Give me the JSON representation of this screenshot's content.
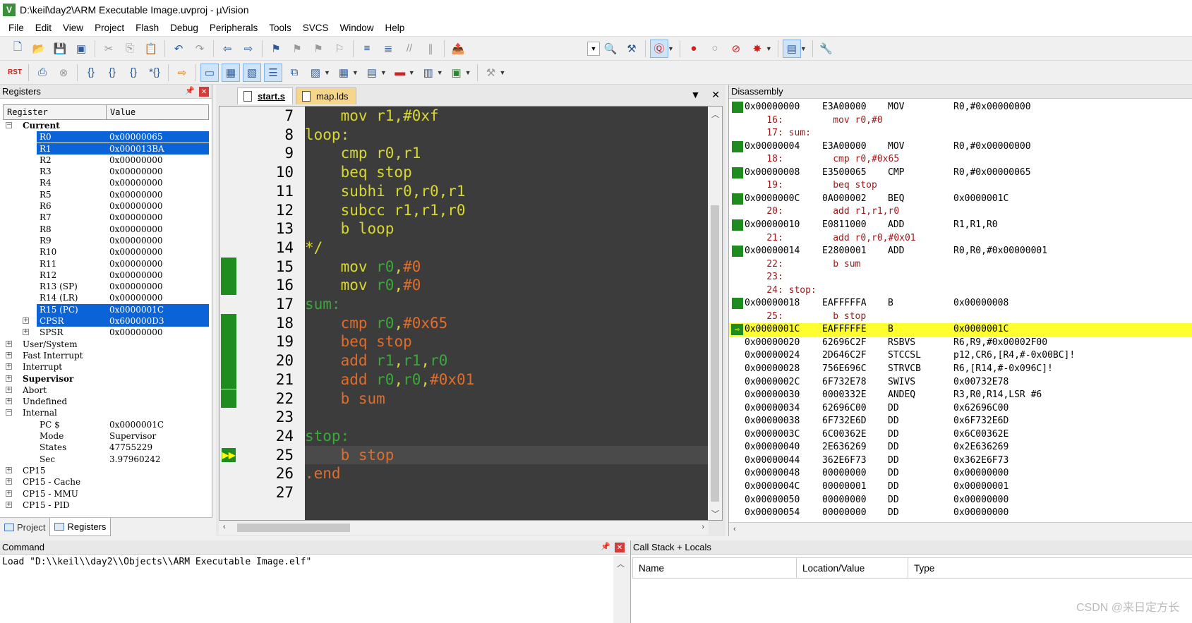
{
  "window": {
    "title": "D:\\keil\\day2\\ARM Executable Image.uvproj - µVision",
    "icon": "V"
  },
  "menu": [
    "File",
    "Edit",
    "View",
    "Project",
    "Flash",
    "Debug",
    "Peripherals",
    "Tools",
    "SVCS",
    "Window",
    "Help"
  ],
  "registers": {
    "title": "Registers",
    "col_register": "Register",
    "col_value": "Value",
    "rows": [
      {
        "name": "Current",
        "value": "",
        "level": 0,
        "exp": "-",
        "bold": true,
        "sel": false
      },
      {
        "name": "R0",
        "value": "0x00000065",
        "level": 2,
        "exp": "",
        "bold": false,
        "sel": true
      },
      {
        "name": "R1",
        "value": "0x000013BA",
        "level": 2,
        "exp": "",
        "bold": false,
        "sel": true
      },
      {
        "name": "R2",
        "value": "0x00000000",
        "level": 2,
        "exp": "",
        "bold": false,
        "sel": false
      },
      {
        "name": "R3",
        "value": "0x00000000",
        "level": 2,
        "exp": "",
        "bold": false,
        "sel": false
      },
      {
        "name": "R4",
        "value": "0x00000000",
        "level": 2,
        "exp": "",
        "bold": false,
        "sel": false
      },
      {
        "name": "R5",
        "value": "0x00000000",
        "level": 2,
        "exp": "",
        "bold": false,
        "sel": false
      },
      {
        "name": "R6",
        "value": "0x00000000",
        "level": 2,
        "exp": "",
        "bold": false,
        "sel": false
      },
      {
        "name": "R7",
        "value": "0x00000000",
        "level": 2,
        "exp": "",
        "bold": false,
        "sel": false
      },
      {
        "name": "R8",
        "value": "0x00000000",
        "level": 2,
        "exp": "",
        "bold": false,
        "sel": false
      },
      {
        "name": "R9",
        "value": "0x00000000",
        "level": 2,
        "exp": "",
        "bold": false,
        "sel": false
      },
      {
        "name": "R10",
        "value": "0x00000000",
        "level": 2,
        "exp": "",
        "bold": false,
        "sel": false
      },
      {
        "name": "R11",
        "value": "0x00000000",
        "level": 2,
        "exp": "",
        "bold": false,
        "sel": false
      },
      {
        "name": "R12",
        "value": "0x00000000",
        "level": 2,
        "exp": "",
        "bold": false,
        "sel": false
      },
      {
        "name": "R13 (SP)",
        "value": "0x00000000",
        "level": 2,
        "exp": "",
        "bold": false,
        "sel": false
      },
      {
        "name": "R14 (LR)",
        "value": "0x00000000",
        "level": 2,
        "exp": "",
        "bold": false,
        "sel": false
      },
      {
        "name": "R15 (PC)",
        "value": "0x0000001C",
        "level": 2,
        "exp": "",
        "bold": false,
        "sel": true
      },
      {
        "name": "CPSR",
        "value": "0x600000D3",
        "level": 2,
        "exp": "+",
        "bold": false,
        "sel": true
      },
      {
        "name": "SPSR",
        "value": "0x00000000",
        "level": 2,
        "exp": "+",
        "bold": false,
        "sel": false
      },
      {
        "name": "User/System",
        "value": "",
        "level": 0,
        "exp": "+",
        "bold": false,
        "sel": false
      },
      {
        "name": "Fast Interrupt",
        "value": "",
        "level": 0,
        "exp": "+",
        "bold": false,
        "sel": false
      },
      {
        "name": "Interrupt",
        "value": "",
        "level": 0,
        "exp": "+",
        "bold": false,
        "sel": false
      },
      {
        "name": "Supervisor",
        "value": "",
        "level": 0,
        "exp": "+",
        "bold": true,
        "sel": false
      },
      {
        "name": "Abort",
        "value": "",
        "level": 0,
        "exp": "+",
        "bold": false,
        "sel": false
      },
      {
        "name": "Undefined",
        "value": "",
        "level": 0,
        "exp": "+",
        "bold": false,
        "sel": false
      },
      {
        "name": "Internal",
        "value": "",
        "level": 0,
        "exp": "-",
        "bold": false,
        "sel": false
      },
      {
        "name": "PC  $",
        "value": "0x0000001C",
        "level": 2,
        "exp": "",
        "bold": false,
        "sel": false
      },
      {
        "name": "Mode",
        "value": "Supervisor",
        "level": 2,
        "exp": "",
        "bold": false,
        "sel": false
      },
      {
        "name": "States",
        "value": "47755229",
        "level": 2,
        "exp": "",
        "bold": false,
        "sel": false
      },
      {
        "name": "Sec",
        "value": "3.97960242",
        "level": 2,
        "exp": "",
        "bold": false,
        "sel": false
      },
      {
        "name": "CP15",
        "value": "",
        "level": 0,
        "exp": "+",
        "bold": false,
        "sel": false
      },
      {
        "name": "CP15 - Cache",
        "value": "",
        "level": 0,
        "exp": "+",
        "bold": false,
        "sel": false
      },
      {
        "name": "CP15 - MMU",
        "value": "",
        "level": 0,
        "exp": "+",
        "bold": false,
        "sel": false
      },
      {
        "name": "CP15 - PID",
        "value": "",
        "level": 0,
        "exp": "+",
        "bold": false,
        "sel": false
      }
    ],
    "tabs": [
      {
        "label": "Project",
        "active": false
      },
      {
        "label": "Registers",
        "active": true
      }
    ]
  },
  "editor": {
    "tabs": [
      {
        "label": "start.s",
        "active": true
      },
      {
        "label": "map.lds",
        "active": false
      }
    ],
    "lines": [
      {
        "num": "7",
        "tokens": [
          [
            "    mov r1,#0xf",
            "kw"
          ]
        ],
        "mark": false,
        "cur": false,
        "arrow": false
      },
      {
        "num": "8",
        "tokens": [
          [
            "loop:",
            "kw"
          ]
        ],
        "mark": false,
        "cur": false,
        "arrow": false
      },
      {
        "num": "9",
        "tokens": [
          [
            "    cmp r0,r1",
            "kw"
          ]
        ],
        "mark": false,
        "cur": false,
        "arrow": false
      },
      {
        "num": "10",
        "tokens": [
          [
            "    beq stop",
            "kw"
          ]
        ],
        "mark": false,
        "cur": false,
        "arrow": false
      },
      {
        "num": "11",
        "tokens": [
          [
            "    subhi r0,r0,r1",
            "kw"
          ]
        ],
        "mark": false,
        "cur": false,
        "arrow": false
      },
      {
        "num": "12",
        "tokens": [
          [
            "    subcc r1,r1,r0",
            "kw"
          ]
        ],
        "mark": false,
        "cur": false,
        "arrow": false
      },
      {
        "num": "13",
        "tokens": [
          [
            "    b loop",
            "kw"
          ]
        ],
        "mark": false,
        "cur": false,
        "arrow": false
      },
      {
        "num": "14",
        "tokens": [
          [
            "*/",
            "kw"
          ]
        ],
        "mark": false,
        "cur": false,
        "arrow": false
      },
      {
        "num": "15",
        "tokens": [
          [
            "    mov ",
            "kw"
          ],
          [
            "r0",
            "rg"
          ],
          [
            ",",
            "kw"
          ],
          [
            "#0",
            "lb2"
          ]
        ],
        "mark": true,
        "cur": false,
        "arrow": false
      },
      {
        "num": "16",
        "tokens": [
          [
            "    mov ",
            "kw"
          ],
          [
            "r0",
            "rg"
          ],
          [
            ",",
            "kw"
          ],
          [
            "#0",
            "lb2"
          ]
        ],
        "mark": true,
        "cur": false,
        "arrow": false
      },
      {
        "num": "17",
        "tokens": [
          [
            "sum:",
            "lb"
          ]
        ],
        "mark": false,
        "cur": false,
        "arrow": false
      },
      {
        "num": "18",
        "tokens": [
          [
            "    cmp ",
            "lb2"
          ],
          [
            "r0",
            "rg"
          ],
          [
            ",",
            "kw"
          ],
          [
            "#0x65",
            "lb2"
          ]
        ],
        "mark": true,
        "cur": false,
        "arrow": false
      },
      {
        "num": "19",
        "tokens": [
          [
            "    beq ",
            "lb2"
          ],
          [
            "stop",
            "lb2"
          ]
        ],
        "mark": true,
        "cur": false,
        "arrow": false
      },
      {
        "num": "20",
        "tokens": [
          [
            "    add ",
            "lb2"
          ],
          [
            "r1",
            "rg"
          ],
          [
            ",",
            "kw"
          ],
          [
            "r1",
            "rg"
          ],
          [
            ",",
            "kw"
          ],
          [
            "r0",
            "rg"
          ]
        ],
        "mark": true,
        "cur": false,
        "arrow": false
      },
      {
        "num": "21",
        "tokens": [
          [
            "    add ",
            "lb2"
          ],
          [
            "r0",
            "rg"
          ],
          [
            ",",
            "kw"
          ],
          [
            "r0",
            "rg"
          ],
          [
            ",",
            "kw"
          ],
          [
            "#0x01",
            "lb2"
          ]
        ],
        "mark": true,
        "cur": false,
        "arrow": false
      },
      {
        "num": "22",
        "tokens": [
          [
            "    b ",
            "lb2"
          ],
          [
            "sum",
            "lb2"
          ]
        ],
        "mark": true,
        "cur": false,
        "arrow": false
      },
      {
        "num": "23",
        "tokens": [
          [
            "",
            "kw"
          ]
        ],
        "mark": false,
        "cur": false,
        "arrow": false
      },
      {
        "num": "24",
        "tokens": [
          [
            "stop:",
            "lb"
          ]
        ],
        "mark": false,
        "cur": false,
        "arrow": false
      },
      {
        "num": "25",
        "tokens": [
          [
            "    b ",
            "lb2"
          ],
          [
            "stop",
            "lb2"
          ]
        ],
        "mark": false,
        "cur": true,
        "arrow": true
      },
      {
        "num": "26",
        "tokens": [
          [
            ".end",
            "dir"
          ]
        ],
        "mark": false,
        "cur": false,
        "arrow": false
      },
      {
        "num": "27",
        "tokens": [
          [
            "",
            "kw"
          ]
        ],
        "mark": false,
        "cur": false,
        "arrow": false
      }
    ]
  },
  "disassembly": {
    "title": "Disassembly",
    "rows": [
      {
        "t": "asm",
        "addr": "0x00000000",
        "op": "E3A00000",
        "mn": "MOV",
        "args": "R0,#0x00000000",
        "mark": true
      },
      {
        "t": "src",
        "text": "    16:         mov r0,#0"
      },
      {
        "t": "src",
        "text": "    17: sum:"
      },
      {
        "t": "asm",
        "addr": "0x00000004",
        "op": "E3A00000",
        "mn": "MOV",
        "args": "R0,#0x00000000",
        "mark": true
      },
      {
        "t": "src",
        "text": "    18:         cmp r0,#0x65"
      },
      {
        "t": "asm",
        "addr": "0x00000008",
        "op": "E3500065",
        "mn": "CMP",
        "args": "R0,#0x00000065",
        "mark": true
      },
      {
        "t": "src",
        "text": "    19:         beq stop"
      },
      {
        "t": "asm",
        "addr": "0x0000000C",
        "op": "0A000002",
        "mn": "BEQ",
        "args": "0x0000001C",
        "mark": true
      },
      {
        "t": "src",
        "text": "    20:         add r1,r1,r0"
      },
      {
        "t": "asm",
        "addr": "0x00000010",
        "op": "E0811000",
        "mn": "ADD",
        "args": "R1,R1,R0",
        "mark": true
      },
      {
        "t": "src",
        "text": "    21:         add r0,r0,#0x01"
      },
      {
        "t": "asm",
        "addr": "0x00000014",
        "op": "E2800001",
        "mn": "ADD",
        "args": "R0,R0,#0x00000001",
        "mark": true
      },
      {
        "t": "src",
        "text": "    22:         b sum"
      },
      {
        "t": "src",
        "text": "    23:"
      },
      {
        "t": "src",
        "text": "    24: stop:"
      },
      {
        "t": "asm",
        "addr": "0x00000018",
        "op": "EAFFFFFA",
        "mn": "B",
        "args": "0x00000008",
        "mark": true
      },
      {
        "t": "src",
        "text": "    25:         b stop"
      },
      {
        "t": "asm",
        "addr": "0x0000001C",
        "op": "EAFFFFFE",
        "mn": "B",
        "args": "0x0000001C",
        "mark": true,
        "hl": true
      },
      {
        "t": "asm",
        "addr": "0x00000020",
        "op": "62696C2F",
        "mn": "RSBVS",
        "args": "R6,R9,#0x00002F00",
        "mark": false
      },
      {
        "t": "asm",
        "addr": "0x00000024",
        "op": "2D646C2F",
        "mn": "STCCSL",
        "args": "p12,CR6,[R4,#-0x00BC]!",
        "mark": false
      },
      {
        "t": "asm",
        "addr": "0x00000028",
        "op": "756E696C",
        "mn": "STRVCB",
        "args": "R6,[R14,#-0x096C]!",
        "mark": false
      },
      {
        "t": "asm",
        "addr": "0x0000002C",
        "op": "6F732E78",
        "mn": "SWIVS",
        "args": "0x00732E78",
        "mark": false
      },
      {
        "t": "asm",
        "addr": "0x00000030",
        "op": "0000332E",
        "mn": "ANDEQ",
        "args": "R3,R0,R14,LSR #6",
        "mark": false
      },
      {
        "t": "asm",
        "addr": "0x00000034",
        "op": "62696C00",
        "mn": "DD",
        "args": "0x62696C00",
        "mark": false
      },
      {
        "t": "asm",
        "addr": "0x00000038",
        "op": "6F732E6D",
        "mn": "DD",
        "args": "0x6F732E6D",
        "mark": false
      },
      {
        "t": "asm",
        "addr": "0x0000003C",
        "op": "6C00362E",
        "mn": "DD",
        "args": "0x6C00362E",
        "mark": false
      },
      {
        "t": "asm",
        "addr": "0x00000040",
        "op": "2E636269",
        "mn": "DD",
        "args": "0x2E636269",
        "mark": false
      },
      {
        "t": "asm",
        "addr": "0x00000044",
        "op": "362E6F73",
        "mn": "DD",
        "args": "0x362E6F73",
        "mark": false
      },
      {
        "t": "asm",
        "addr": "0x00000048",
        "op": "00000000",
        "mn": "DD",
        "args": "0x00000000",
        "mark": false
      },
      {
        "t": "asm",
        "addr": "0x0000004C",
        "op": "00000001",
        "mn": "DD",
        "args": "0x00000001",
        "mark": false
      },
      {
        "t": "asm",
        "addr": "0x00000050",
        "op": "00000000",
        "mn": "DD",
        "args": "0x00000000",
        "mark": false
      },
      {
        "t": "asm",
        "addr": "0x00000054",
        "op": "00000000",
        "mn": "DD",
        "args": "0x00000000",
        "mark": false
      }
    ]
  },
  "command": {
    "title": "Command",
    "text": "Load \"D:\\\\keil\\\\day2\\\\Objects\\\\ARM Executable Image.elf\""
  },
  "callstack": {
    "title": "Call Stack + Locals",
    "cols": [
      "Name",
      "Location/Value",
      "Type"
    ]
  },
  "watermark": "CSDN @来日定方长",
  "colors": {
    "selection": "#0a64d8",
    "breakpoint_green": "#1e8c1e",
    "current_line": "#ffff30",
    "code_bg": "#3c3c3c"
  }
}
